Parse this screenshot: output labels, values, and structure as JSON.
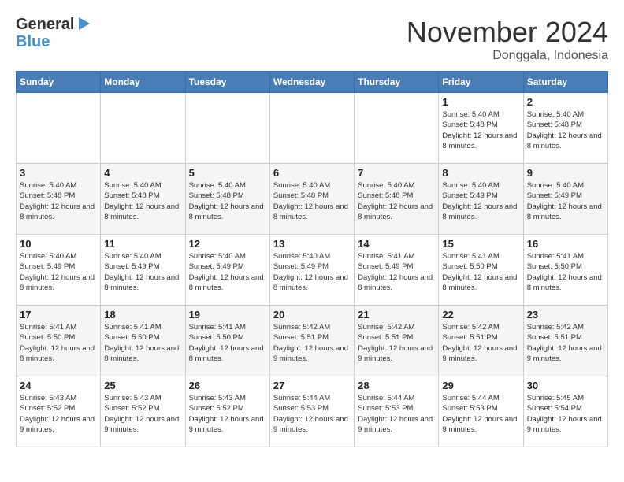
{
  "header": {
    "logo_line1": "General",
    "logo_line2": "Blue",
    "month": "November 2024",
    "location": "Donggala, Indonesia"
  },
  "weekdays": [
    "Sunday",
    "Monday",
    "Tuesday",
    "Wednesday",
    "Thursday",
    "Friday",
    "Saturday"
  ],
  "weeks": [
    [
      {
        "day": "",
        "content": ""
      },
      {
        "day": "",
        "content": ""
      },
      {
        "day": "",
        "content": ""
      },
      {
        "day": "",
        "content": ""
      },
      {
        "day": "",
        "content": ""
      },
      {
        "day": "1",
        "content": "Sunrise: 5:40 AM\nSunset: 5:48 PM\nDaylight: 12 hours and 8 minutes."
      },
      {
        "day": "2",
        "content": "Sunrise: 5:40 AM\nSunset: 5:48 PM\nDaylight: 12 hours and 8 minutes."
      }
    ],
    [
      {
        "day": "3",
        "content": "Sunrise: 5:40 AM\nSunset: 5:48 PM\nDaylight: 12 hours and 8 minutes."
      },
      {
        "day": "4",
        "content": "Sunrise: 5:40 AM\nSunset: 5:48 PM\nDaylight: 12 hours and 8 minutes."
      },
      {
        "day": "5",
        "content": "Sunrise: 5:40 AM\nSunset: 5:48 PM\nDaylight: 12 hours and 8 minutes."
      },
      {
        "day": "6",
        "content": "Sunrise: 5:40 AM\nSunset: 5:48 PM\nDaylight: 12 hours and 8 minutes."
      },
      {
        "day": "7",
        "content": "Sunrise: 5:40 AM\nSunset: 5:48 PM\nDaylight: 12 hours and 8 minutes."
      },
      {
        "day": "8",
        "content": "Sunrise: 5:40 AM\nSunset: 5:49 PM\nDaylight: 12 hours and 8 minutes."
      },
      {
        "day": "9",
        "content": "Sunrise: 5:40 AM\nSunset: 5:49 PM\nDaylight: 12 hours and 8 minutes."
      }
    ],
    [
      {
        "day": "10",
        "content": "Sunrise: 5:40 AM\nSunset: 5:49 PM\nDaylight: 12 hours and 8 minutes."
      },
      {
        "day": "11",
        "content": "Sunrise: 5:40 AM\nSunset: 5:49 PM\nDaylight: 12 hours and 8 minutes."
      },
      {
        "day": "12",
        "content": "Sunrise: 5:40 AM\nSunset: 5:49 PM\nDaylight: 12 hours and 8 minutes."
      },
      {
        "day": "13",
        "content": "Sunrise: 5:40 AM\nSunset: 5:49 PM\nDaylight: 12 hours and 8 minutes."
      },
      {
        "day": "14",
        "content": "Sunrise: 5:41 AM\nSunset: 5:49 PM\nDaylight: 12 hours and 8 minutes."
      },
      {
        "day": "15",
        "content": "Sunrise: 5:41 AM\nSunset: 5:50 PM\nDaylight: 12 hours and 8 minutes."
      },
      {
        "day": "16",
        "content": "Sunrise: 5:41 AM\nSunset: 5:50 PM\nDaylight: 12 hours and 8 minutes."
      }
    ],
    [
      {
        "day": "17",
        "content": "Sunrise: 5:41 AM\nSunset: 5:50 PM\nDaylight: 12 hours and 8 minutes."
      },
      {
        "day": "18",
        "content": "Sunrise: 5:41 AM\nSunset: 5:50 PM\nDaylight: 12 hours and 8 minutes."
      },
      {
        "day": "19",
        "content": "Sunrise: 5:41 AM\nSunset: 5:50 PM\nDaylight: 12 hours and 8 minutes."
      },
      {
        "day": "20",
        "content": "Sunrise: 5:42 AM\nSunset: 5:51 PM\nDaylight: 12 hours and 9 minutes."
      },
      {
        "day": "21",
        "content": "Sunrise: 5:42 AM\nSunset: 5:51 PM\nDaylight: 12 hours and 9 minutes."
      },
      {
        "day": "22",
        "content": "Sunrise: 5:42 AM\nSunset: 5:51 PM\nDaylight: 12 hours and 9 minutes."
      },
      {
        "day": "23",
        "content": "Sunrise: 5:42 AM\nSunset: 5:51 PM\nDaylight: 12 hours and 9 minutes."
      }
    ],
    [
      {
        "day": "24",
        "content": "Sunrise: 5:43 AM\nSunset: 5:52 PM\nDaylight: 12 hours and 9 minutes."
      },
      {
        "day": "25",
        "content": "Sunrise: 5:43 AM\nSunset: 5:52 PM\nDaylight: 12 hours and 9 minutes."
      },
      {
        "day": "26",
        "content": "Sunrise: 5:43 AM\nSunset: 5:52 PM\nDaylight: 12 hours and 9 minutes."
      },
      {
        "day": "27",
        "content": "Sunrise: 5:44 AM\nSunset: 5:53 PM\nDaylight: 12 hours and 9 minutes."
      },
      {
        "day": "28",
        "content": "Sunrise: 5:44 AM\nSunset: 5:53 PM\nDaylight: 12 hours and 9 minutes."
      },
      {
        "day": "29",
        "content": "Sunrise: 5:44 AM\nSunset: 5:53 PM\nDaylight: 12 hours and 9 minutes."
      },
      {
        "day": "30",
        "content": "Sunrise: 5:45 AM\nSunset: 5:54 PM\nDaylight: 12 hours and 9 minutes."
      }
    ]
  ]
}
